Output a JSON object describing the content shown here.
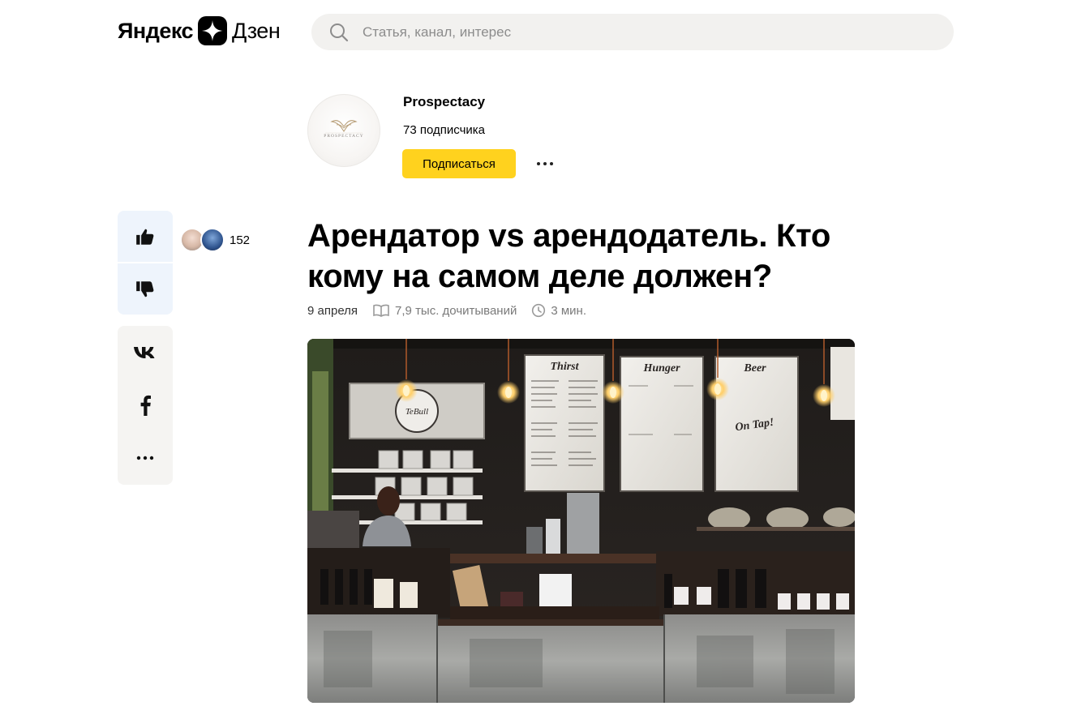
{
  "header": {
    "logo_yandex": "Яндекс",
    "logo_dzen": "Дзен",
    "search_placeholder": "Статья, канал, интерес"
  },
  "channel": {
    "name": "Prospectacy",
    "avatar_text": "PROSPECTACY",
    "subscribers": "73 подписчика",
    "subscribe_label": "Подписаться"
  },
  "reactions": {
    "like_count": "152"
  },
  "article": {
    "title": "Арендатор vs арендодатель. Кто кому на самом деле должен?",
    "date": "9 апреля",
    "reads": "7,9 тыс. дочитываний",
    "read_time": "3 мин."
  },
  "hero_image": {
    "boards": [
      "Thirst",
      "Hunger",
      "Beer"
    ],
    "tap_text": "On Tap!",
    "logo_text": "TeBull"
  },
  "icons": [
    "search-icon",
    "thumb-up-icon",
    "thumb-down-icon",
    "vk-icon",
    "facebook-icon",
    "more-icon",
    "book-icon",
    "clock-icon"
  ],
  "colors": {
    "accent": "#ffd21e",
    "search_bg": "#f2f1ef",
    "rail_bg": "#eef4fc"
  }
}
